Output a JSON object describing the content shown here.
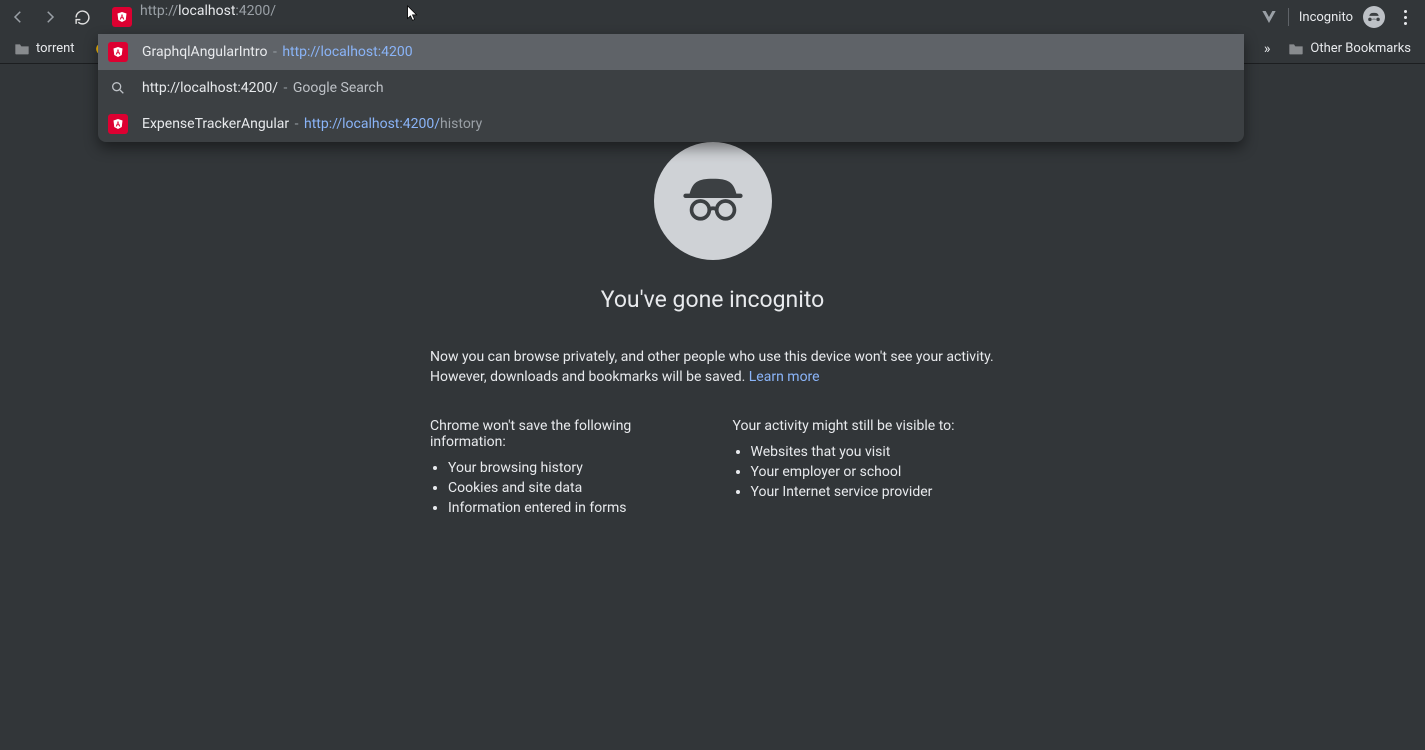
{
  "toolbar": {
    "url_proto": "http://",
    "url_host": "localhost",
    "url_rest": ":4200/",
    "incognito_label": "Incognito"
  },
  "bookmarks": {
    "item1": "torrent",
    "other": "Other Bookmarks",
    "overflow": "»"
  },
  "suggestions": [
    {
      "icon": "angular",
      "title": "GraphqlAngularIntro",
      "dash": " - ",
      "url": "http://localhost:4200",
      "url_suffix": "",
      "extra": "",
      "selected": true
    },
    {
      "icon": "search",
      "title": "http://localhost:4200/",
      "dash": " - ",
      "url": "",
      "url_suffix": "",
      "extra": "Google Search",
      "selected": false
    },
    {
      "icon": "angular",
      "title": "ExpenseTrackerAngular",
      "dash": " - ",
      "url": "http://localhost:4200/",
      "url_suffix": "history",
      "extra": "",
      "selected": false
    }
  ],
  "page": {
    "heading": "You've gone incognito",
    "desc1": "Now you can browse privately, and other people who use this device won't see your activity. However, downloads and bookmarks will be saved. ",
    "learn": "Learn more",
    "col1_title": "Chrome won't save the following information:",
    "col1_items": [
      "Your browsing history",
      "Cookies and site data",
      "Information entered in forms"
    ],
    "col2_title": "Your activity might still be visible to:",
    "col2_items": [
      "Websites that you visit",
      "Your employer or school",
      "Your Internet service provider"
    ]
  }
}
